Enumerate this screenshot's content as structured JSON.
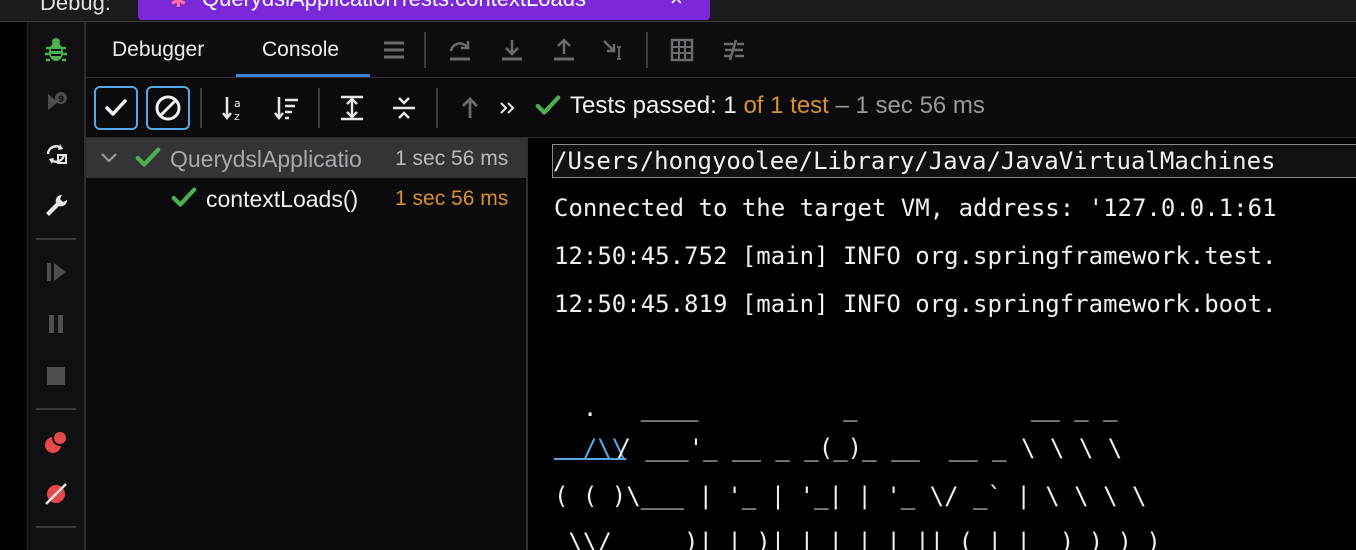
{
  "top_strip": {
    "debug_label": "Debug:",
    "run_tab_title": "QuerydslApplicationTests.contextLoads",
    "close_glyph": "×",
    "run_tab_color": "#7b28d8"
  },
  "left_toolbar": {
    "items": [
      "bug-icon",
      "rerun-icon",
      "restart-icon",
      "wrench-icon",
      "resume-icon",
      "pause-icon",
      "stop-icon",
      "view-breakpoints-icon",
      "mute-breakpoints-icon"
    ]
  },
  "tabs": {
    "debugger": "Debugger",
    "console": "Console",
    "active": "Console",
    "accent": "#3d7fd8"
  },
  "runner": {
    "status_prefix": "Tests passed:",
    "passed_count": "1",
    "of_total": "of 1 test",
    "duration": "– 1 sec 56 ms",
    "success_color": "#4caf50",
    "orange": "#d9902e"
  },
  "tree": {
    "root": {
      "name": "QuerydslApplicatio",
      "time": "1 sec 56 ms"
    },
    "child": {
      "name": "contextLoads()",
      "time": "1 sec 56 ms"
    }
  },
  "console": {
    "lines": [
      "/Users/hongyoolee/Library/Java/JavaVirtualMachines",
      "Connected to the target VM, address: '127.0.0.1:61",
      "12:50:45.752 [main] INFO org.springframework.test.",
      "12:50:45.819 [main] INFO org.springframework.boot.",
      "",
      "  .   ____          _            __ _ _",
      "  /\\\\",
      " / ___'_ __ _ _(_)_ __  __ _ \\ \\ \\ \\",
      "( ( )\\___ | '_ | '_| | '_ \\/ _` | \\ \\ \\ \\",
      " \\\\/  ___)| |_)| | | | | || (_| |  ) ) ) )"
    ],
    "link_color": "#5aa7e6"
  }
}
